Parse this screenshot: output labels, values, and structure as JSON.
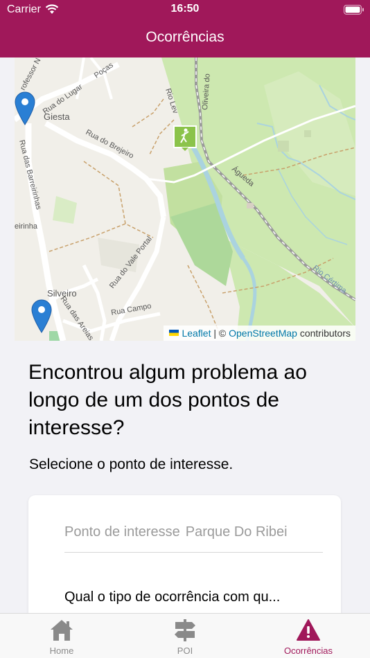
{
  "status_bar": {
    "carrier": "Carrier",
    "time": "16:50"
  },
  "header": {
    "title": "Ocorrências"
  },
  "map": {
    "labels": {
      "professor": "rofessor N",
      "lugar": "Rua do Lugar",
      "pocas": "Poças",
      "giesta": "Giesta",
      "brejeiro": "Rua do Brejeiro",
      "barreirinhas": "Rua das Barreirinhas",
      "leirinha": "eirinha",
      "vale_portal": "Rua do Vale Portal",
      "silveiro": "Silveiro",
      "areias": "Rua das Areias",
      "campo": "Rua Campo",
      "oliveira": "Oliveira do",
      "rio_lev": "Rio Lev",
      "agueda": "Águeda",
      "rio_cerima": "Rio Cértima"
    },
    "attribution": {
      "leaflet": "Leaflet",
      "separator": "| ©",
      "osm": "OpenStreetMap",
      "contributors": "contributors"
    }
  },
  "content": {
    "question": "Encontrou algum problema ao longo de um dos pontos de interesse?",
    "instruction": "Selecione o ponto de interesse."
  },
  "form": {
    "poi_label": "Ponto de interesse",
    "poi_value": "Parque Do Ribei",
    "occurrence_type_label": "Qual o tipo de ocorrência com qu..."
  },
  "tabs": [
    {
      "label": "Home",
      "icon": "home-icon",
      "active": false
    },
    {
      "label": "POI",
      "icon": "signpost-icon",
      "active": false
    },
    {
      "label": "Ocorrências",
      "icon": "warning-icon",
      "active": true
    }
  ],
  "colors": {
    "accent": "#a0185a",
    "map_green": "#cde8b0",
    "water": "#aad3df",
    "marker_blue": "#2a7fd4"
  }
}
